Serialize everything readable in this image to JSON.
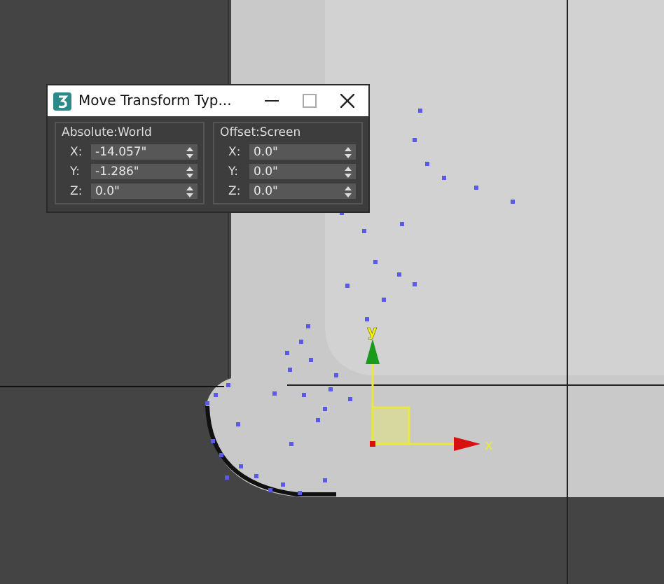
{
  "dialog": {
    "title": "Move Transform Typ...",
    "groups": [
      {
        "label": "Absolute:World",
        "fields": [
          {
            "axis": "X:",
            "value": "-14.057\""
          },
          {
            "axis": "Y:",
            "value": "-1.286\""
          },
          {
            "axis": "Z:",
            "value": "0.0\""
          }
        ]
      },
      {
        "label": "Offset:Screen",
        "fields": [
          {
            "axis": "X:",
            "value": "0.0\""
          },
          {
            "axis": "Y:",
            "value": "0.0\""
          },
          {
            "axis": "Z:",
            "value": "0.0\""
          }
        ]
      }
    ]
  },
  "viewport": {
    "gizmo": {
      "x_label": "x",
      "y_label": "y"
    }
  }
}
